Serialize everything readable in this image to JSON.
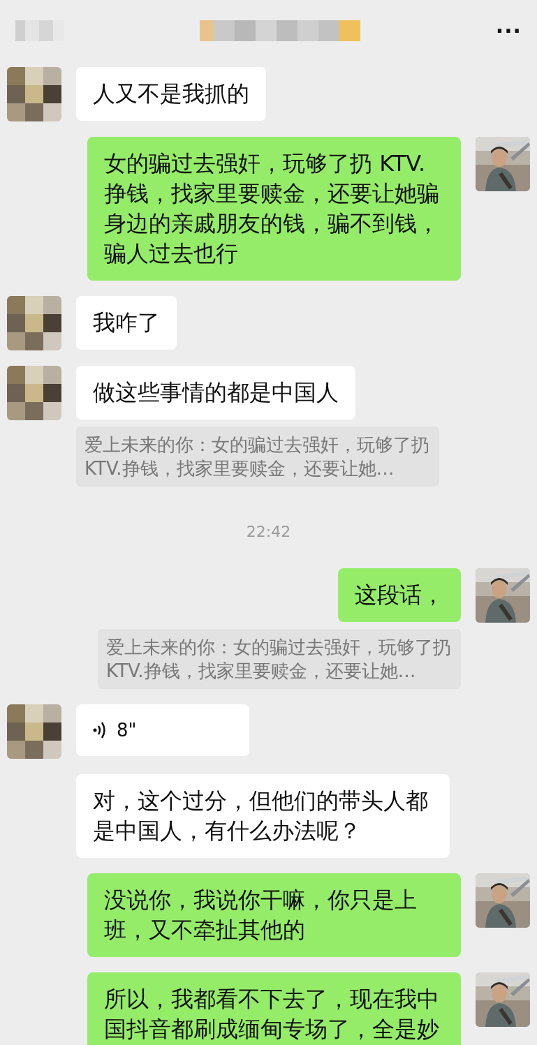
{
  "header": {
    "more": "···"
  },
  "messages": [
    {
      "outgoing": false,
      "show_avatar": true,
      "kind": "text",
      "text": "人又不是我抓的"
    },
    {
      "outgoing": true,
      "show_avatar": true,
      "kind": "text",
      "text": "女的骗过去强奸，玩够了扔 KTV.挣钱，找家里要赎金，还要让她骗身边的亲戚朋友的钱，骗不到钱，骗人过去也行"
    },
    {
      "outgoing": false,
      "show_avatar": true,
      "kind": "text",
      "text": "我咋了"
    },
    {
      "outgoing": false,
      "show_avatar": true,
      "kind": "text",
      "text": "做这些事情的都是中国人",
      "quote": "爱上未来的你：女的骗过去强奸，玩够了扔KTV.挣钱，找家里要赎金，还要让她…"
    },
    {
      "kind": "time",
      "text": "22:42"
    },
    {
      "outgoing": true,
      "show_avatar": true,
      "kind": "text",
      "text": "这段话，",
      "quote": "爱上未来的你：女的骗过去强奸，玩够了扔KTV.挣钱，找家里要赎金，还要让她…"
    },
    {
      "outgoing": false,
      "show_avatar": true,
      "kind": "voice",
      "text": "8\""
    },
    {
      "outgoing": false,
      "show_avatar": false,
      "kind": "text",
      "text": "对，这个过分，但他们的带头人都是中国人，有什么办法呢？"
    },
    {
      "outgoing": true,
      "show_avatar": true,
      "kind": "text",
      "text": "没说你，我说你干嘛，你只是上班，又不牵扯其他的"
    },
    {
      "outgoing": true,
      "show_avatar": true,
      "kind": "text",
      "text": "所以，我都看不下去了，现在我中国抖音都刷成缅甸专场了，全是妙"
    }
  ]
}
